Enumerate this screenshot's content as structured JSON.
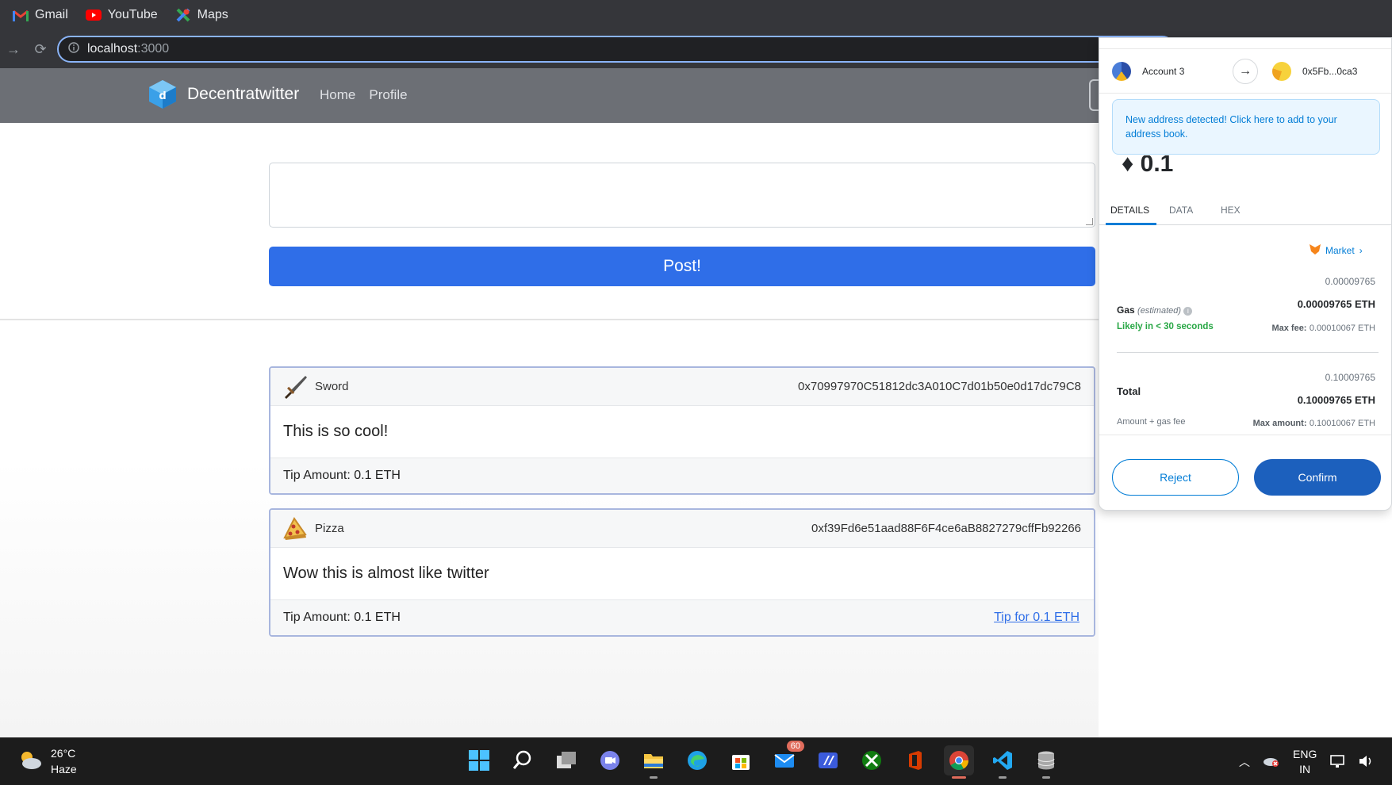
{
  "browser": {
    "bookmarks": [
      {
        "label": "Gmail",
        "icon": "gmail-icon"
      },
      {
        "label": "YouTube",
        "icon": "youtube-icon"
      },
      {
        "label": "Maps",
        "icon": "maps-icon"
      }
    ],
    "url_host": "localhost",
    "url_port": ":3000"
  },
  "app": {
    "brand": "Decentratwitter",
    "nav": [
      "Home",
      "Profile"
    ],
    "post_button": "Post!",
    "posts": [
      {
        "author": "Sword",
        "address": "0x70997970C51812dc3A010C7d01b50e0d17dc79C8",
        "content": "This is so cool!",
        "tip_amount": "Tip Amount: 0.1 ETH",
        "tip_link": ""
      },
      {
        "author": "Pizza",
        "address": "0xf39Fd6e51aad88F6F4ce6aB8827279cffFb92266",
        "content": "Wow this is almost like twitter",
        "tip_amount": "Tip Amount: 0.1 ETH",
        "tip_link": "Tip for 0.1 ETH"
      }
    ]
  },
  "metamask": {
    "from_account": "Account 3",
    "to_account": "0x5Fb...0ca3",
    "notice": "New address detected! Click here to add to your address book.",
    "amount": "0.1",
    "tabs": [
      "DETAILS",
      "DATA",
      "HEX"
    ],
    "market": "Market",
    "gas_label": "Gas",
    "gas_estimated": "(estimated)",
    "gas_value": "0.00009765",
    "gas_value_eth": "0.00009765 ETH",
    "likely": "Likely in < 30 seconds",
    "max_fee_label": "Max fee:",
    "max_fee_value": "0.00010067 ETH",
    "total_label": "Total",
    "total_value": "0.10009765",
    "total_value_eth": "0.10009765 ETH",
    "amount_gas_label": "Amount + gas fee",
    "max_amount_label": "Max amount:",
    "max_amount_value": "0.10010067 ETH",
    "reject": "Reject",
    "confirm": "Confirm"
  },
  "taskbar": {
    "temperature": "26°C",
    "weather": "Haze",
    "mail_badge": "60",
    "lang_top": "ENG",
    "lang_bottom": "IN"
  }
}
